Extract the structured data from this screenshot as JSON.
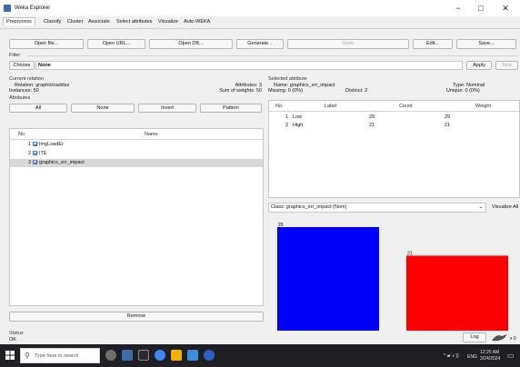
{
  "window": {
    "title": "Weka Explorer",
    "minimize": "−",
    "maximize": "□",
    "close": "✕"
  },
  "tabs": [
    "Preprocess",
    "Classify",
    "Cluster",
    "Associate",
    "Select attributes",
    "Visualize",
    "Auto-WEKA"
  ],
  "toolbar": {
    "open_file": "Open file...",
    "open_url": "Open URL...",
    "open_db": "Open DB...",
    "generate": "Generate...",
    "undo": "Undo",
    "edit": "Edit...",
    "save": "Save..."
  },
  "filter": {
    "label": "Filter",
    "choose": "Choose",
    "value": "None",
    "apply": "Apply",
    "stop": "Stop"
  },
  "current_relation": {
    "label": "Current relation",
    "relation_label": "Relation:",
    "relation": "graphicloaddss",
    "instances_label": "Instances:",
    "instances": "50",
    "attributes_label": "Attributes:",
    "attributes": "3",
    "weights_label": "Sum of weights:",
    "weights": "50"
  },
  "attributes_panel": {
    "label": "Attributes",
    "all": "All",
    "none": "None",
    "invert": "Invert",
    "pattern": "Pattern",
    "col_no": "No.",
    "col_name": "Name",
    "rows": [
      {
        "no": "1",
        "name": "ImgLoadEr"
      },
      {
        "no": "2",
        "name": "ITE"
      },
      {
        "no": "3",
        "name": "graphics_err_impact"
      }
    ],
    "remove": "Remove"
  },
  "selected_attribute": {
    "label": "Selected attribute",
    "name_label": "Name:",
    "name": "graphics_err_impact",
    "type_label": "Type:",
    "type": "Nominal",
    "missing_label": "Missing:",
    "missing": "0 (0%)",
    "distinct_label": "Distinct:",
    "distinct": "2",
    "unique_label": "Unique:",
    "unique": "0 (0%)",
    "col_no": "No.",
    "col_label": "Label",
    "col_count": "Count",
    "col_weight": "Weight",
    "rows": [
      {
        "no": "1",
        "label": "Low",
        "count": "29",
        "weight": "29"
      },
      {
        "no": "2",
        "label": "High",
        "count": "21",
        "weight": "21"
      }
    ]
  },
  "class_select": {
    "value": "Class: graphics_err_impact (Nom)",
    "visualize_all": "Visualize All"
  },
  "chart_data": {
    "type": "bar",
    "categories": [
      "Low",
      "High"
    ],
    "values": [
      29,
      21
    ],
    "colors": [
      "#0000ff",
      "#ff0000"
    ],
    "data_labels": [
      "29",
      "21"
    ]
  },
  "status": {
    "label": "Status",
    "text": "OK",
    "log": "Log",
    "xcount": "x 0"
  },
  "taskbar": {
    "search_placeholder": "Type here to search",
    "tray_lang": "ENG",
    "time": "12:25 AM",
    "date": "3/24/2024"
  }
}
